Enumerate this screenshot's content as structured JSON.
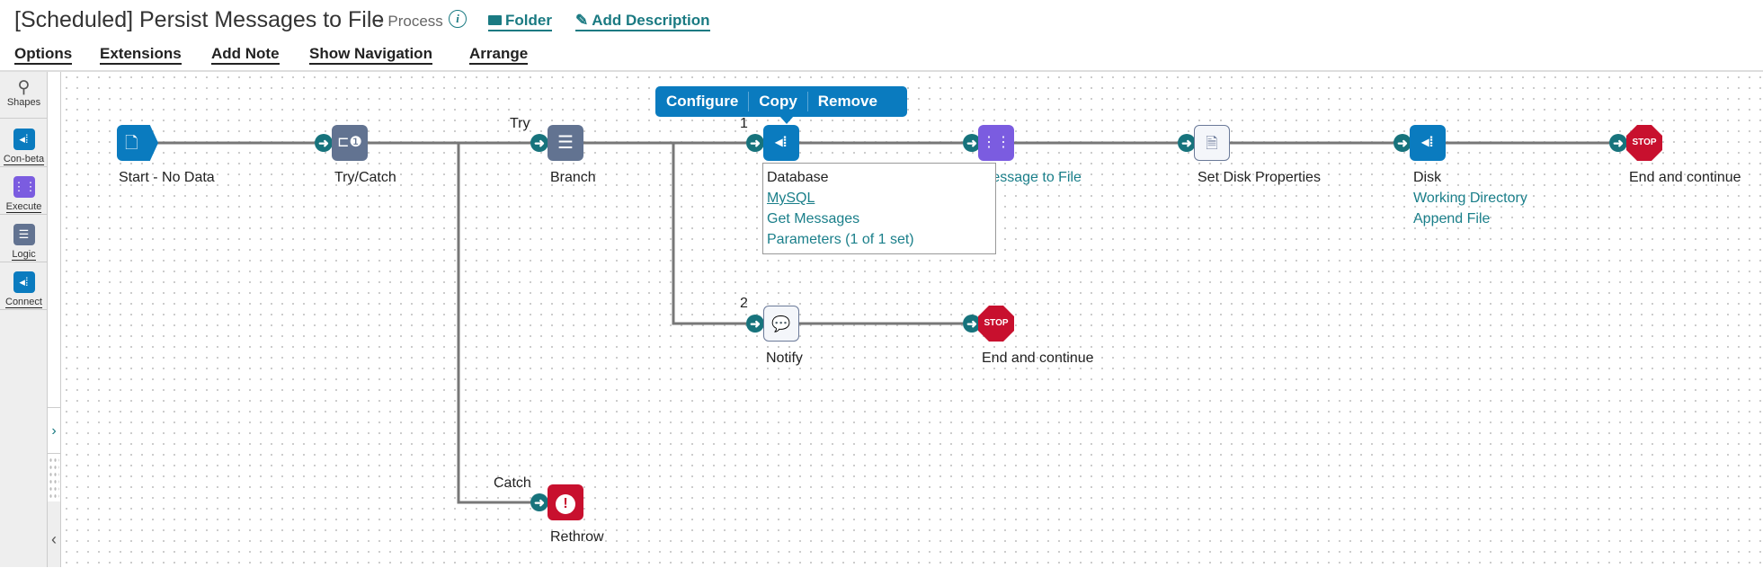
{
  "header": {
    "title": "[Scheduled] Persist Messages to File",
    "subtitle": "- Process",
    "info_icon": "info-icon",
    "folder_label": "Folder",
    "add_description_label": "Add Description"
  },
  "menu": {
    "options": "Options",
    "extensions": "Extensions",
    "add_note": "Add Note",
    "show_navigation": "Show Navigation",
    "arrange": "Arrange"
  },
  "sidebar": {
    "items": [
      {
        "label": "Shapes",
        "icon": "search-icon"
      },
      {
        "label": "Con-beta",
        "icon": "connector-icon",
        "color": "#0a7bbf"
      },
      {
        "label": "Execute",
        "icon": "execute-icon",
        "color": "#7b5ce0"
      },
      {
        "label": "Logic",
        "icon": "logic-icon",
        "color": "#627391"
      },
      {
        "label": "Connect",
        "icon": "connector-icon",
        "color": "#0a7bbf"
      }
    ]
  },
  "colors": {
    "connector": "#0a7bbf",
    "execute": "#7b5ce0",
    "logic": "#627391",
    "stop": "#c8102e",
    "link": "#1a7f8a",
    "port": "#17737c"
  },
  "popup": {
    "configure": "Configure",
    "copy": "Copy",
    "remove": "Remove"
  },
  "tooltip": {
    "type": "Database",
    "connection": "MySQL",
    "operation": "Get Messages",
    "parameters": "Parameters (1 of 1 set)"
  },
  "nodes": {
    "start": {
      "label": "Start - No Data"
    },
    "trycatch": {
      "label": "Try/Catch"
    },
    "branch": {
      "label": "Branch"
    },
    "database": {
      "label": "Database"
    },
    "message": {
      "label": "Message to File"
    },
    "setdisk": {
      "label": "Set Disk Properties"
    },
    "disk": {
      "label": "Disk",
      "line1": "Working Directory",
      "line2": "Append File"
    },
    "end1": {
      "label": "End and continue",
      "stop_text": "STOP"
    },
    "notify": {
      "label": "Notify"
    },
    "end2": {
      "label": "End and continue",
      "stop_text": "STOP"
    },
    "rethrow": {
      "label": "Rethrow"
    }
  },
  "edge_labels": {
    "try": "Try",
    "catch": "Catch",
    "branch1": "1",
    "branch2": "2"
  }
}
